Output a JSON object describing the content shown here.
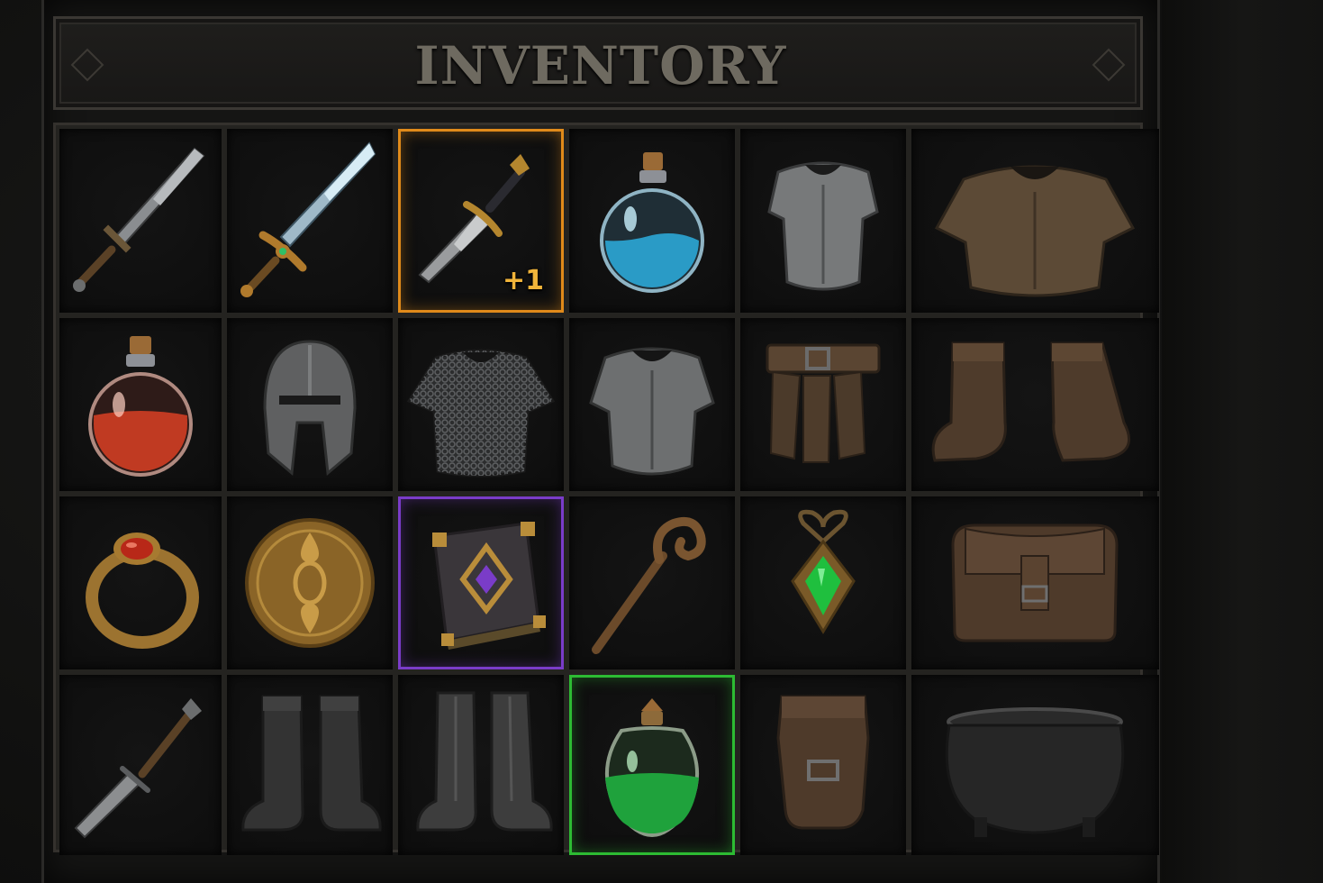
{
  "title": "INVENTORY",
  "highlight_colors": {
    "rare_orange": "#e08a1a",
    "epic_purple": "#7a3cc8",
    "uncommon_green": "#2dbb33"
  },
  "slots": [
    {
      "item": "iron-sword-icon"
    },
    {
      "item": "enchanted-sword-icon"
    },
    {
      "item": "dagger-icon",
      "badge": "+1",
      "highlight": "orange"
    },
    {
      "item": "blue-potion-icon"
    },
    {
      "item": "steel-chestplate-icon"
    },
    {
      "item": "leather-pauldron-armor-icon"
    },
    {
      "item": "red-potion-icon"
    },
    {
      "item": "iron-helmet-icon"
    },
    {
      "item": "chainmail-shirt-icon"
    },
    {
      "item": "plate-cuirass-icon"
    },
    {
      "item": "leather-belt-skirt-icon"
    },
    {
      "item": "leather-boots-icon"
    },
    {
      "item": "ruby-ring-icon"
    },
    {
      "item": "gold-medallion-icon"
    },
    {
      "item": "spellbook-icon",
      "highlight": "purple"
    },
    {
      "item": "wooden-staff-icon"
    },
    {
      "item": "emerald-amulet-icon"
    },
    {
      "item": "leather-satchel-icon"
    },
    {
      "item": "short-sword-icon"
    },
    {
      "item": "dark-boots-icon"
    },
    {
      "item": "iron-greaves-icon"
    },
    {
      "item": "green-potion-icon",
      "highlight": "green"
    },
    {
      "item": "leather-gloves-icon"
    },
    {
      "item": "iron-cauldron-icon"
    }
  ]
}
